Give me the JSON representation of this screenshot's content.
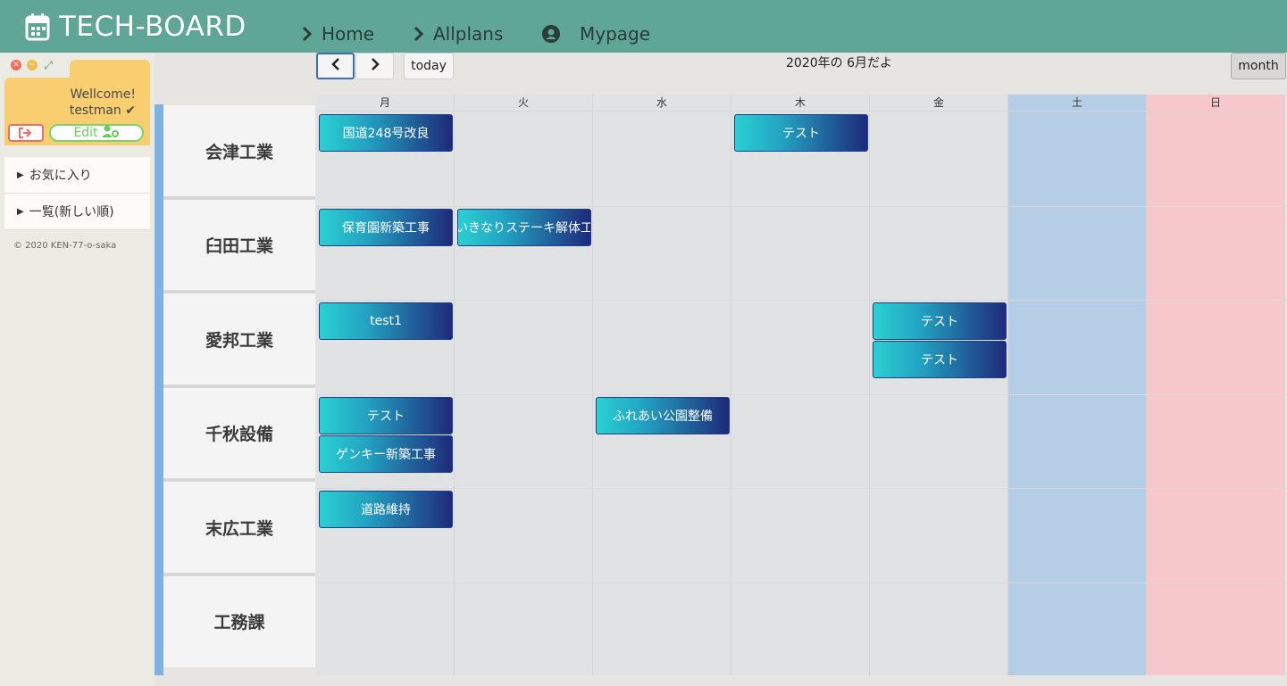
{
  "header": {
    "brand": "TECH-BOARD",
    "nav": [
      {
        "label": "Home",
        "icon": "chevron-right-icon"
      },
      {
        "label": "Allplans",
        "icon": "chevron-right-icon"
      },
      {
        "label": "Mypage",
        "icon": "user-circle-icon"
      }
    ],
    "colors": {
      "bar": "#5fa697"
    }
  },
  "sidebar": {
    "welcome": "Wellcome!",
    "username": "testman",
    "logout_icon": "sign-out-icon",
    "edit_label": "Edit",
    "menu": [
      {
        "label": "お気に入り"
      },
      {
        "label": "一覧(新しい順)"
      }
    ],
    "copyright": "© 2020 KEN-77-o-saka"
  },
  "toolbar": {
    "prev_icon": "chevron-left-icon",
    "next_icon": "chevron-right-icon",
    "today_label": "today",
    "title": "2020年の 6月だよ",
    "month_label": "month"
  },
  "calendar": {
    "days": [
      "月",
      "火",
      "水",
      "木",
      "金",
      "土",
      "日"
    ],
    "day_colors": [
      "#e1e2e3",
      "#e1e2e3",
      "#e1e2e3",
      "#e1e2e3",
      "#e1e2e3",
      "#b5cde5",
      "#f6c8cc"
    ],
    "resources": [
      "会津工業",
      "臼田工業",
      "愛邦工業",
      "千秋設備",
      "末広工業",
      "工務課"
    ],
    "events": [
      {
        "label": "国道248号改良",
        "resource": 0,
        "day": 0,
        "slot": 0
      },
      {
        "label": "テスト",
        "resource": 0,
        "day": 3,
        "slot": 0
      },
      {
        "label": "保育園新築工事",
        "resource": 1,
        "day": 0,
        "slot": 0
      },
      {
        "label": "いきなりステーキ解体工",
        "resource": 1,
        "day": 1,
        "slot": 0
      },
      {
        "label": "test1",
        "resource": 2,
        "day": 0,
        "slot": 0
      },
      {
        "label": "テスト",
        "resource": 2,
        "day": 4,
        "slot": 0
      },
      {
        "label": "テスト",
        "resource": 2,
        "day": 4,
        "slot": 1
      },
      {
        "label": "テスト",
        "resource": 3,
        "day": 0,
        "slot": 0
      },
      {
        "label": "ゲンキー新築工事",
        "resource": 3,
        "day": 0,
        "slot": 1
      },
      {
        "label": "ふれあい公園整備",
        "resource": 3,
        "day": 2,
        "slot": 0
      },
      {
        "label": "道路維持",
        "resource": 4,
        "day": 0,
        "slot": 0
      }
    ]
  }
}
